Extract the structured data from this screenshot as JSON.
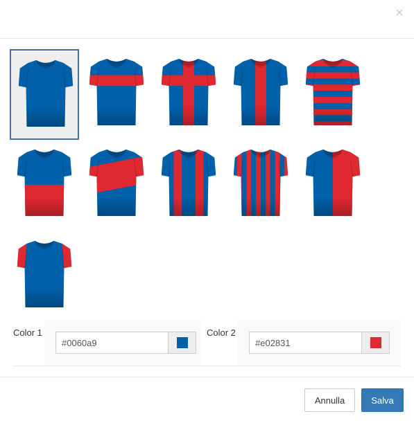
{
  "dialog": {
    "close_icon": "close-icon",
    "jerseys": [
      {
        "id": "plain",
        "selected": true
      },
      {
        "id": "chest-band",
        "selected": false
      },
      {
        "id": "cross",
        "selected": false
      },
      {
        "id": "center-stripe",
        "selected": false
      },
      {
        "id": "hoops",
        "selected": false
      },
      {
        "id": "bottom-half",
        "selected": false
      },
      {
        "id": "diagonal-band",
        "selected": false
      },
      {
        "id": "two-stripes",
        "selected": false
      },
      {
        "id": "vertical-stripes",
        "selected": false
      },
      {
        "id": "split-halves",
        "selected": false
      },
      {
        "id": "contrast-sleeves",
        "selected": false
      }
    ],
    "color1": {
      "label": "Color 1",
      "value": "#0060a9"
    },
    "color2": {
      "label": "Color 2",
      "value": "#e02831"
    },
    "footer": {
      "cancel_label": "Annulla",
      "save_label": "Salva"
    }
  },
  "colors": {
    "primary": "#0060a9",
    "secondary": "#e02831",
    "save_button": "#337ab7",
    "selected_border": "#45709e"
  }
}
